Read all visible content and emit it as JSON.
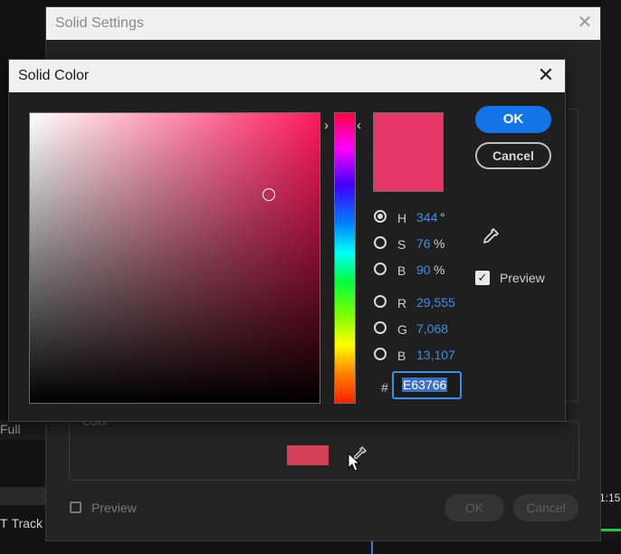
{
  "background": {
    "full_label": "Full",
    "track_row": [
      "T",
      "Track"
    ],
    "timecode": "1:15"
  },
  "solid_settings": {
    "title": "Solid Settings",
    "close_glyph": "✕",
    "color_group_label": "Color",
    "swatch_color": "#d24155",
    "preview_label": "Preview",
    "ok_label": "OK",
    "cancel_label": "Cancel"
  },
  "solid_color": {
    "title": "Solid Color",
    "close_glyph": "✕",
    "hue_arrow_left": "›",
    "hue_arrow_right": "‹",
    "preview_color": "#e63766",
    "hsb": [
      {
        "letter": "H",
        "value": "344",
        "unit": "°",
        "selected": true
      },
      {
        "letter": "S",
        "value": "76",
        "unit": "%",
        "selected": false
      },
      {
        "letter": "B",
        "value": "90",
        "unit": "%",
        "selected": false
      }
    ],
    "rgb": [
      {
        "letter": "R",
        "value": "29,555",
        "selected": false
      },
      {
        "letter": "G",
        "value": "7,068",
        "selected": false
      },
      {
        "letter": "B",
        "value": "13,107",
        "selected": false
      }
    ],
    "hash": "#",
    "hex_value": "E63766",
    "ok_label": "OK",
    "cancel_label": "Cancel",
    "preview_label": "Preview",
    "preview_checked": true,
    "check_glyph": "✓"
  }
}
